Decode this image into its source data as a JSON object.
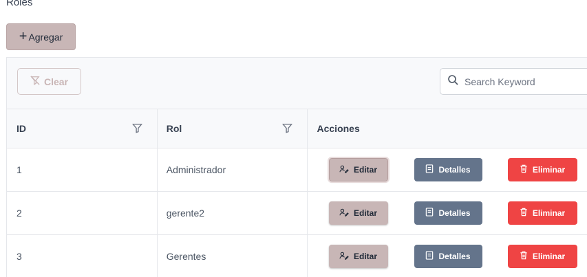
{
  "page": {
    "title": "Roles"
  },
  "toolbar": {
    "add_label": "Agregar",
    "clear_label": "Clear",
    "search_placeholder": "Search Keyword"
  },
  "table": {
    "columns": [
      "ID",
      "Rol",
      "Acciones"
    ],
    "rows": [
      {
        "id": "1",
        "rol": "Administrador"
      },
      {
        "id": "2",
        "rol": "gerente2"
      },
      {
        "id": "3",
        "rol": "Gerentes"
      }
    ],
    "actions": {
      "edit": "Editar",
      "details": "Detalles",
      "delete": "Eliminar"
    }
  },
  "colors": {
    "accent": "#c8b6b6",
    "details": "#64748b",
    "danger": "#ef4444"
  },
  "icons": {
    "add": "plus-icon",
    "clear": "filter-slash-icon",
    "search": "search-icon",
    "filter": "filter-icon",
    "edit": "user-edit-icon",
    "details": "document-icon",
    "delete": "trash-icon"
  }
}
